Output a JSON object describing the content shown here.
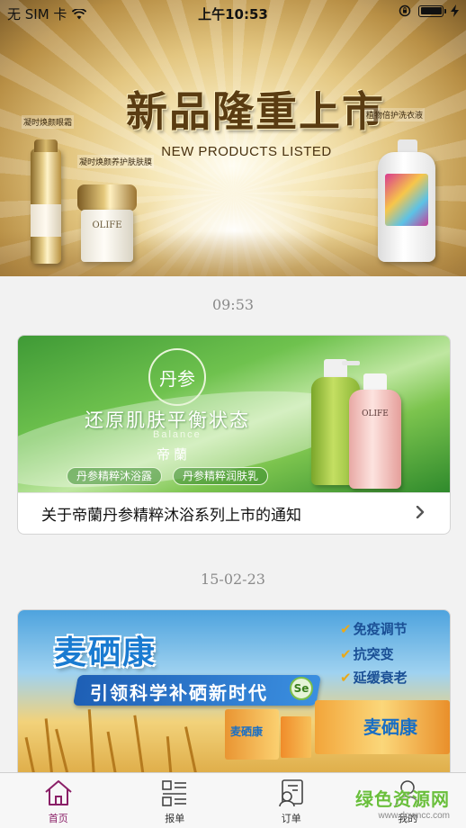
{
  "status_bar": {
    "carrier": "无 SIM 卡",
    "time": "上午10:53"
  },
  "hero": {
    "title": "新品隆重上市",
    "subtitle": "NEW PRODUCTS LISTED",
    "tag_left_top": "凝时焕颜眼霜",
    "tag_left_bottom": "凝时焕颜养护肤肤膜",
    "tag_right": "植物倍护洗衣液",
    "jar_label": "OLIFE"
  },
  "feed": [
    {
      "time": "09:53",
      "caption": "关于帝蘭丹参精粹沐浴系列上市的通知",
      "image": {
        "seal": "丹参",
        "headline": "还原肌肤平衡状态",
        "sub": "Balance",
        "brand": "帝蘭",
        "pill1": "丹参精粹沐浴露",
        "pill2": "丹参精粹润肤乳",
        "bottle_label": "OLIFE"
      }
    },
    {
      "time": "15-02-23",
      "image": {
        "title": "麦硒康",
        "slogan": "引领科学补硒新时代",
        "feature1": "免疫调节",
        "feature2": "抗突变",
        "feature3": "延缓衰老",
        "box_label": "麦硒康",
        "small_box_label": "麦硒康",
        "badge": "Se"
      }
    }
  ],
  "tabbar": {
    "items": [
      {
        "label": "首页",
        "icon": "home-icon",
        "active": true
      },
      {
        "label": "报单",
        "icon": "list-icon",
        "active": false
      },
      {
        "label": "订单",
        "icon": "order-icon",
        "active": false
      },
      {
        "label": "我的",
        "icon": "user-icon",
        "active": false
      }
    ],
    "active_color": "#8a1f67"
  },
  "watermark": {
    "text": "绿色资源网",
    "url": "www.downcc.com"
  }
}
